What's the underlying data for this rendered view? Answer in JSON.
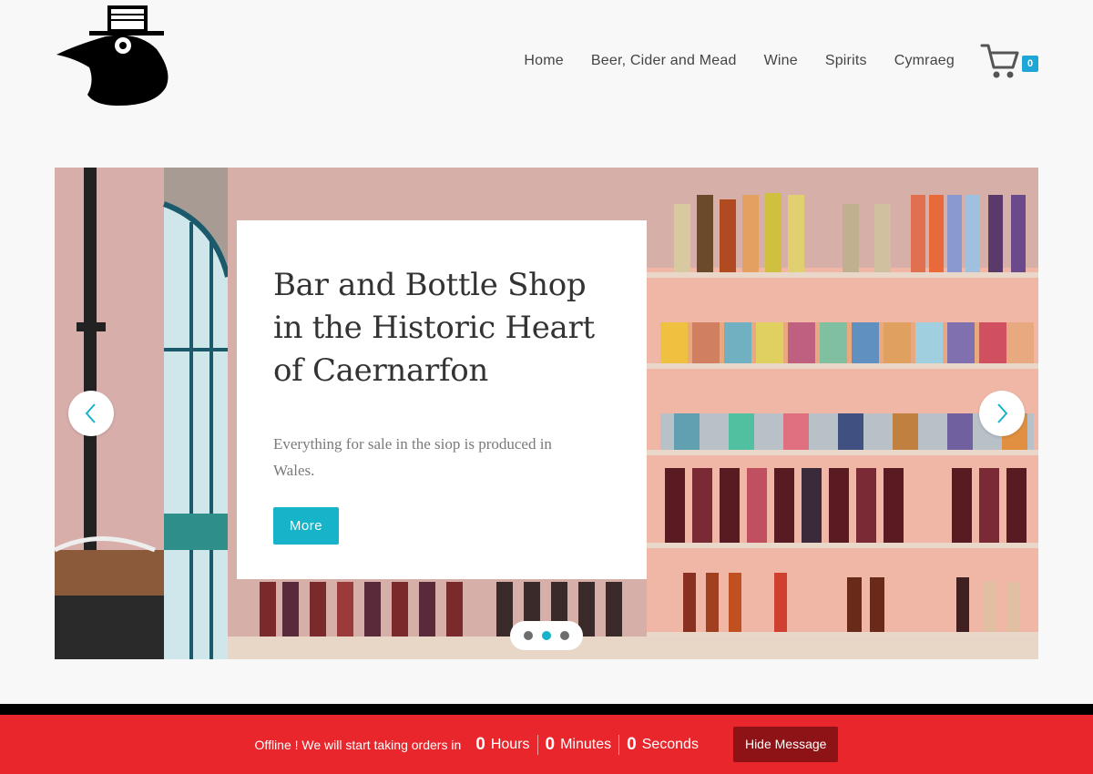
{
  "header": {
    "logo_alt": "crow with top hat logo",
    "nav": [
      {
        "label": "Home"
      },
      {
        "label": "Beer, Cider and Mead"
      },
      {
        "label": "Wine"
      },
      {
        "label": "Spirits"
      },
      {
        "label": "Cymraeg"
      }
    ],
    "cart_icon": "shopping-cart-icon",
    "cart_count": "0"
  },
  "slider": {
    "title": "Bar and Bottle Shop in the Historic Heart of Caernarfon",
    "text": "Everything for sale in the siop is produced in Wales.",
    "button_label": "More",
    "prev_icon": "chevron-left-icon",
    "next_icon": "chevron-right-icon",
    "dots_count": 3,
    "active_dot": 1
  },
  "offline_notice": {
    "message": "Offline ! We will start taking orders in",
    "hours_value": "0",
    "hours_label": "Hours",
    "minutes_value": "0",
    "minutes_label": "Minutes",
    "seconds_value": "0",
    "seconds_label": "Seconds",
    "hide_button": "Hide Message"
  },
  "colors": {
    "accent": "#16b3c9",
    "badge": "#1ea7d6",
    "offline_bar": "#e8262b",
    "hide_button": "#8e1316"
  }
}
